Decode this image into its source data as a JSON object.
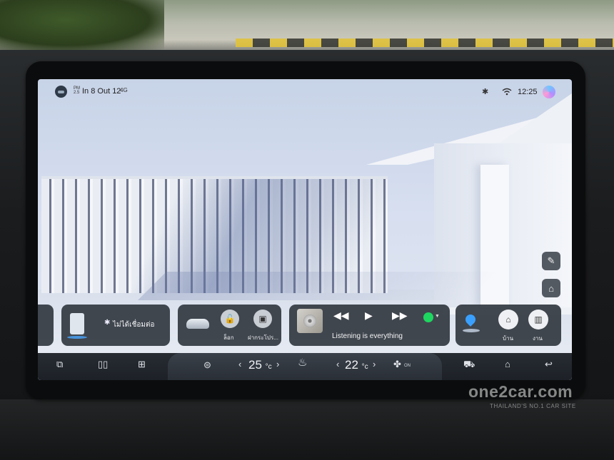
{
  "status_bar": {
    "weather": "PM 2.5",
    "date": "In 8 Out 12",
    "signal": "4G",
    "bluetooth_icon": "bluetooth-icon",
    "wifi_icon": "wifi-icon",
    "time": "12:25"
  },
  "side_buttons": [
    "edit-widget-icon",
    "home-screen-icon"
  ],
  "phone_widget": {
    "label": "ไม่ได้เชื่อมต่อ"
  },
  "car_widget": {
    "lock_label": "ล็อก",
    "trunk_label": "ฝากระโปร..."
  },
  "media_widget": {
    "track": "Listening is everything",
    "source": "Spotify"
  },
  "nav_widget": {
    "home_label": "บ้าน",
    "work_label": "งาน"
  },
  "dock": {
    "driver_temp": "25",
    "passenger_temp": "22",
    "unit": "°c",
    "fan_status": "ON"
  },
  "watermark": {
    "brand": "one2car.com",
    "tagline": "THAILAND'S NO.1 CAR SITE"
  }
}
